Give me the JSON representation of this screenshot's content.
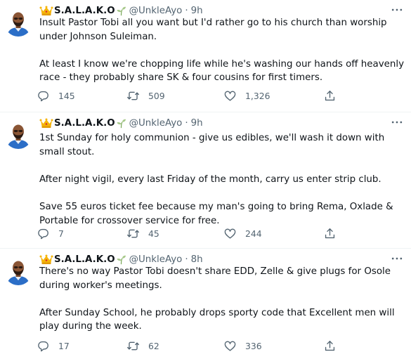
{
  "colors": {
    "text": "#0f1419",
    "muted": "#536471",
    "divider": "#eff3f4",
    "avatar_bg": "#ffffff"
  },
  "icons": {
    "crown": "crown-emoji",
    "plant": "seedling-emoji",
    "more": "more-horizontal-icon",
    "reply": "reply-icon",
    "retweet": "retweet-icon",
    "like": "heart-icon",
    "share": "share-icon"
  },
  "tweets": [
    {
      "display_name": "S.A.L.A.K.O",
      "handle": "@UnkleAyo",
      "separator": "·",
      "time": "9h",
      "paragraphs": [
        "Insult Pastor Tobi all you want but I'd rather go to his church than worship under Johnson Suleiman.",
        "At least I know we're chopping life while he's washing our hands off heavenly race - they probably share SK & four cousins for first timers."
      ],
      "replies": "145",
      "retweets": "509",
      "likes": "1,326"
    },
    {
      "display_name": "S.A.L.A.K.O",
      "handle": "@UnkleAyo",
      "separator": "·",
      "time": "9h",
      "paragraphs": [
        "1st Sunday for holy communion - give us edibles, we'll wash it down with small stout.",
        "After night vigil, every last Friday of the month, carry us enter strip club.",
        "Save 55 euros ticket fee because my man's going to bring Rema, Oxlade & Portable for crossover service for free."
      ],
      "replies": "7",
      "retweets": "45",
      "likes": "244"
    },
    {
      "display_name": "S.A.L.A.K.O",
      "handle": "@UnkleAyo",
      "separator": "·",
      "time": "8h",
      "paragraphs": [
        "There's no way Pastor Tobi doesn't share EDD, Zelle & give plugs for Osole during worker's meetings.",
        "After Sunday School, he probably drops sporty code that Excellent men will play during the week."
      ],
      "replies": "17",
      "retweets": "62",
      "likes": "336"
    }
  ]
}
